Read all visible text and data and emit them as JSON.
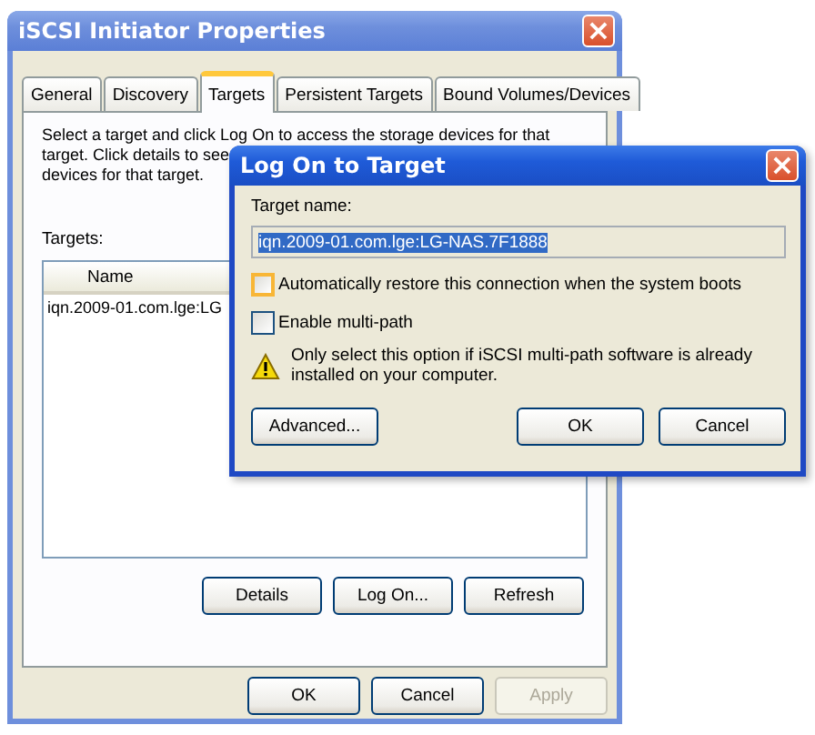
{
  "window": {
    "title": "iSCSI Initiator Properties",
    "close": "×"
  },
  "tabs": [
    {
      "label": "General",
      "selected": false
    },
    {
      "label": "Discovery",
      "selected": false
    },
    {
      "label": "Targets",
      "selected": true
    },
    {
      "label": "Persistent Targets",
      "selected": false
    },
    {
      "label": "Bound Volumes/Devices",
      "selected": false
    }
  ],
  "description_lines": [
    "Select a target and click Log On to access the storage devices for that",
    "target. Click details to see",
    "devices for that target."
  ],
  "targets_label": "Targets:",
  "table": {
    "columns": [
      "Name"
    ],
    "rows": [
      [
        "iqn.2009-01.com.lge:LG"
      ]
    ]
  },
  "panel_buttons": [
    {
      "label": "Details",
      "disabled": false
    },
    {
      "label": "Log On...",
      "disabled": false
    },
    {
      "label": "Refresh",
      "disabled": false
    }
  ],
  "footer_buttons": [
    {
      "label": "OK",
      "disabled": false
    },
    {
      "label": "Cancel",
      "disabled": false
    },
    {
      "label": "Apply",
      "disabled": true
    }
  ],
  "dialog": {
    "title": "Log On to Target",
    "close": "×",
    "field_label": "Target name:",
    "field_value": "iqn.2009-01.com.lge:LG-NAS.7F1888",
    "options": [
      {
        "label": "Automatically restore this connection when the system boots",
        "checked": false,
        "highlighted": true
      },
      {
        "label": "Enable multi-path",
        "checked": false,
        "highlighted": false
      }
    ],
    "warning": "Only select this option if iSCSI multi-path software is already installed on your computer.",
    "buttons": [
      {
        "label": "Advanced...",
        "kind": "left"
      },
      {
        "label": "OK",
        "kind": "right"
      },
      {
        "label": "Cancel",
        "kind": "right"
      }
    ]
  }
}
